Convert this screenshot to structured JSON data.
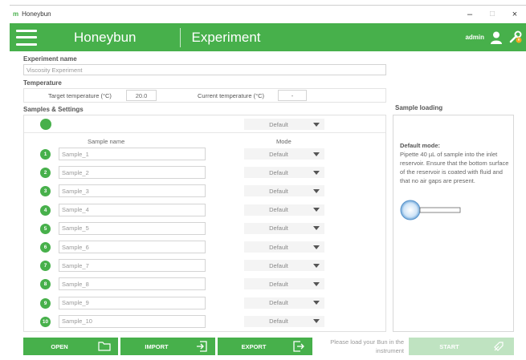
{
  "window": {
    "logo": "m",
    "title": "Honeybun",
    "minimize": "–",
    "maximize": "□",
    "close": "×"
  },
  "appbar": {
    "brand": "Honeybun",
    "page": "Experiment",
    "user": "admin",
    "icons": [
      "menu-icon",
      "user-icon",
      "wrench-alert-icon"
    ],
    "accent": "#47b04b"
  },
  "experiment": {
    "name_label": "Experiment name",
    "name_value": "Viscosity Experiment"
  },
  "temperature": {
    "label": "Temperature",
    "target_label": "Target temperature (°C)",
    "target_value": "20.0",
    "current_label": "Current temperature (°C)",
    "current_value": "-"
  },
  "samples": {
    "label": "Samples & Settings",
    "global_mode": "Default",
    "col_name": "Sample name",
    "col_mode": "Mode",
    "rows": [
      {
        "num": "1",
        "name": "Sample_1",
        "mode": "Default"
      },
      {
        "num": "2",
        "name": "Sample_2",
        "mode": "Default"
      },
      {
        "num": "3",
        "name": "Sample_3",
        "mode": "Default"
      },
      {
        "num": "4",
        "name": "Sample_4",
        "mode": "Default"
      },
      {
        "num": "5",
        "name": "Sample_5",
        "mode": "Default"
      },
      {
        "num": "6",
        "name": "Sample_6",
        "mode": "Default"
      },
      {
        "num": "7",
        "name": "Sample_7",
        "mode": "Default"
      },
      {
        "num": "8",
        "name": "Sample_8",
        "mode": "Default"
      },
      {
        "num": "9",
        "name": "Sample_9",
        "mode": "Default"
      },
      {
        "num": "10",
        "name": "Sample_10",
        "mode": "Default"
      }
    ]
  },
  "loading": {
    "label": "Sample loading",
    "mode_title": "Default mode:",
    "description": "Pipette 40 µL of sample into the inlet reservoir. Ensure that the bottom surface of the reservoir is coated with fluid and that no air gaps are present."
  },
  "actions": {
    "open": "OPEN",
    "import": "IMPORT",
    "export": "EXPORT",
    "hint": "Please load your Bun in the instrument",
    "start": "START"
  }
}
